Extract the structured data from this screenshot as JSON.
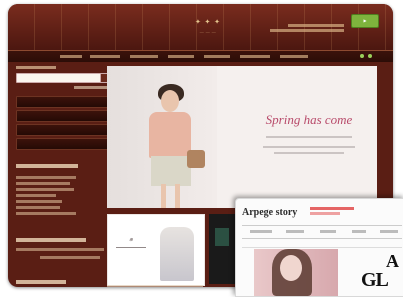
{
  "hero": {
    "title": "Spring has come"
  },
  "inset": {
    "title": "Arpege story",
    "headline_letter": "A",
    "headline_word": "GL"
  }
}
